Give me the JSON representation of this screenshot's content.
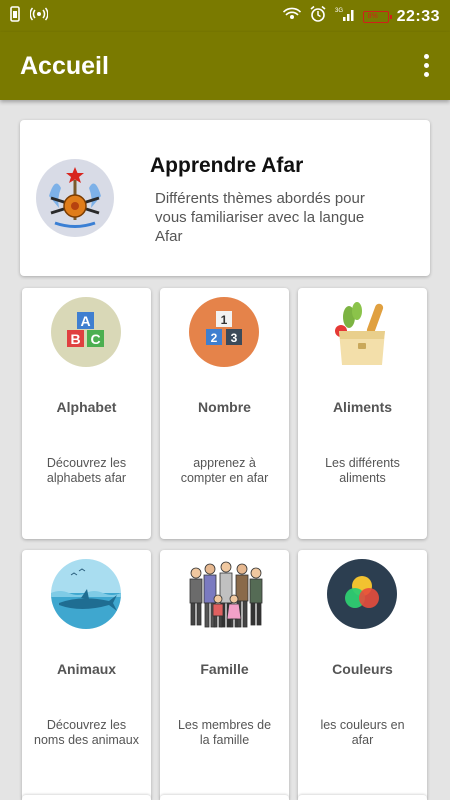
{
  "status_bar": {
    "time": "22:33",
    "battery": "8%"
  },
  "app_bar": {
    "title": "Accueil",
    "menu_icon": "more-vertical-icon"
  },
  "header_card": {
    "title": "Apprendre Afar",
    "description": "Différents thèmes abordés pour vous familiariser avec la langue Afar"
  },
  "categories": [
    {
      "name": "Alphabet",
      "description": "Découvrez les alphabets afar",
      "icon": "abc-blocks-icon"
    },
    {
      "name": "Nombre",
      "description": "apprenez à compter en afar",
      "icon": "number-blocks-icon"
    },
    {
      "name": "Aliments",
      "description": "Les différents aliments",
      "icon": "grocery-bag-icon"
    },
    {
      "name": "Animaux",
      "description": "Découvrez les noms des animaux",
      "icon": "shark-icon"
    },
    {
      "name": "Famille",
      "description": "Les membres de la famille",
      "icon": "family-icon"
    },
    {
      "name": "Couleurs",
      "description": "les couleurs en afar",
      "icon": "color-circles-icon"
    }
  ]
}
